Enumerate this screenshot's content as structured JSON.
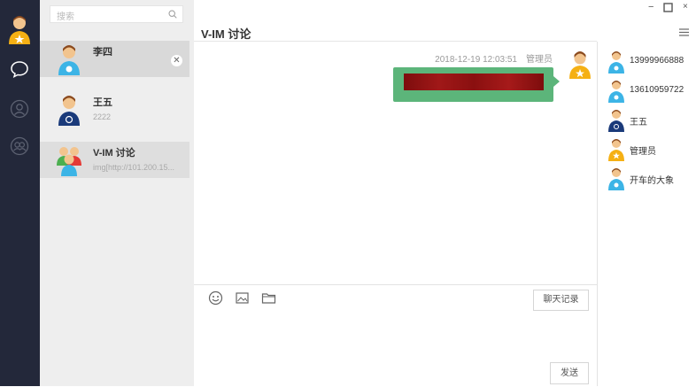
{
  "sidebar": {
    "icons": [
      "user-avatar-admin",
      "chat-bubble-icon",
      "contacts-icon",
      "group-icon"
    ]
  },
  "search": {
    "placeholder": "搜索"
  },
  "conversations": [
    {
      "name": "李四",
      "preview": "",
      "avatar": "qq-blue"
    },
    {
      "name": "王五",
      "preview": "2222",
      "avatar": "wordpress-blue"
    },
    {
      "name": "V-IM 讨论",
      "preview": "img[http://101.200.15...",
      "avatar": "group"
    }
  ],
  "chat": {
    "title": "V-IM 讨论",
    "messages": [
      {
        "time": "2018-12-19 12:03:51",
        "sender": "管理员",
        "type": "image"
      }
    ],
    "history_label": "聊天记录",
    "send_label": "发送"
  },
  "members": [
    {
      "name": "13999966888",
      "avatar": "qq-blue"
    },
    {
      "name": "13610959722",
      "avatar": "qq-blue"
    },
    {
      "name": "王五",
      "avatar": "wordpress-blue"
    },
    {
      "name": "管理员",
      "avatar": "star-yellow"
    },
    {
      "name": "开车的大象",
      "avatar": "qq-blue"
    }
  ],
  "window_controls": [
    "minimize",
    "maximize",
    "close"
  ],
  "colors": {
    "sidebar_bg": "#23283a",
    "bubble": "#5cb57a",
    "list_bg": "#eeeeee"
  }
}
